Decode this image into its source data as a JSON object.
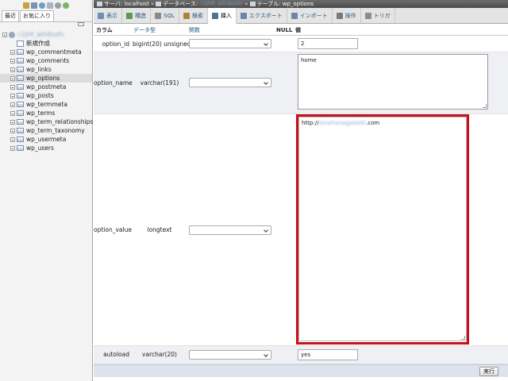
{
  "nav": {
    "tabs": [
      "最近",
      "お気に入り"
    ],
    "database": "c1jhfi_wfn8oxfn",
    "new_label": "新規作成",
    "tables": [
      {
        "name": "wp_commentmeta",
        "selected": false
      },
      {
        "name": "wp_comments",
        "selected": false
      },
      {
        "name": "wp_links",
        "selected": false
      },
      {
        "name": "wp_options",
        "selected": true
      },
      {
        "name": "wp_postmeta",
        "selected": false
      },
      {
        "name": "wp_posts",
        "selected": false
      },
      {
        "name": "wp_termmeta",
        "selected": false
      },
      {
        "name": "wp_terms",
        "selected": false
      },
      {
        "name": "wp_term_relationships",
        "selected": false
      },
      {
        "name": "wp_term_taxonomy",
        "selected": false
      },
      {
        "name": "wp_usermeta",
        "selected": false
      },
      {
        "name": "wp_users",
        "selected": false
      }
    ]
  },
  "breadcrumb": {
    "server": "サーバ: localhost",
    "database_prefix": "データベース: ",
    "database_name": "c1jhfi_wfn8oxfn",
    "table": "テーブル: wp_options"
  },
  "tabs": [
    {
      "label": "表示",
      "icon": "browse-icon",
      "color": "#6b8fb8"
    },
    {
      "label": "構造",
      "icon": "structure-icon",
      "color": "#5a9b5a"
    },
    {
      "label": "SQL",
      "icon": "sql-icon",
      "color": "#8a8a8a"
    },
    {
      "label": "検索",
      "icon": "search-icon",
      "color": "#b0813a"
    },
    {
      "label": "挿入",
      "icon": "insert-icon",
      "color": "#4f6f95",
      "active": true
    },
    {
      "label": "エクスポート",
      "icon": "export-icon",
      "color": "#6c86a8"
    },
    {
      "label": "インポート",
      "icon": "import-icon",
      "color": "#6c86a8"
    },
    {
      "label": "操作",
      "icon": "operations-icon",
      "color": "#7a7a7a"
    },
    {
      "label": "トリガ",
      "icon": "triggers-icon",
      "color": "#8c8c8c"
    }
  ],
  "form": {
    "headers": {
      "column": "カラム",
      "type": "データ型",
      "function": "関数",
      "null": "NULL",
      "value": "値"
    },
    "rows": [
      {
        "name": "option_id",
        "type": "bigint(20) unsigned",
        "value": "2"
      },
      {
        "name": "option_name",
        "type": "varchar(191)",
        "value": "home"
      },
      {
        "name": "option_value",
        "type": "longtext",
        "value_prefix": "http://",
        "value_masked": "sinamanegaisekt",
        "value_suffix": ".com"
      },
      {
        "name": "autoload",
        "type": "varchar(20)",
        "value": "yes"
      }
    ],
    "submit_label": "実行"
  },
  "colors": {
    "highlight": "#c8101a",
    "link": "#235a81"
  }
}
